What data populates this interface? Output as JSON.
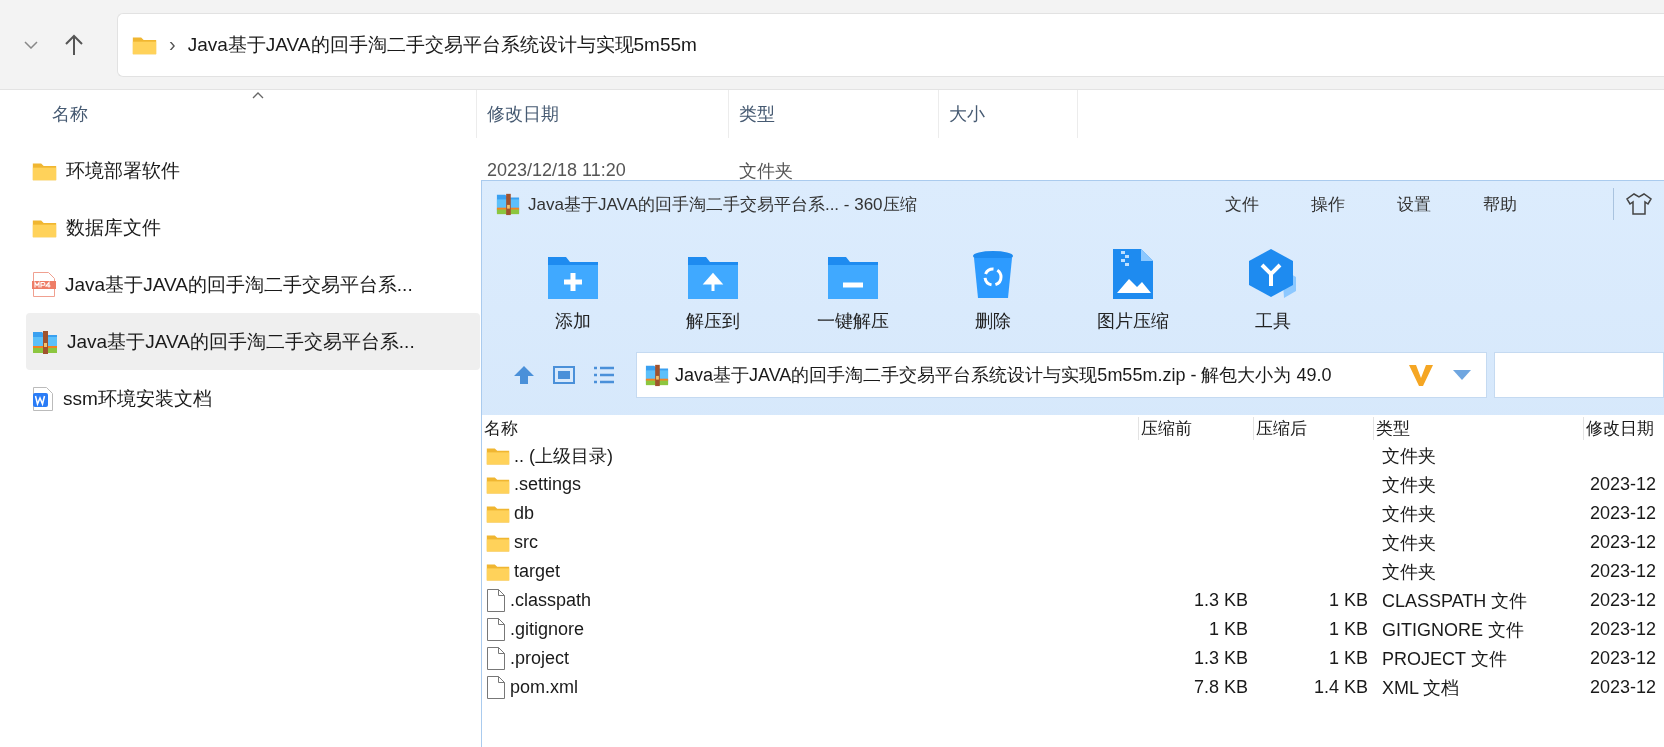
{
  "explorer": {
    "path": "Java基于JAVA的回手淘二手交易平台系统设计与实现5m55m",
    "path_separator": "›",
    "columns": [
      "名称",
      "修改日期",
      "类型",
      "大小"
    ],
    "rows": [
      {
        "kind": "folder",
        "name": "环境部署软件",
        "date": "2023/12/18 11:20",
        "type": "文件夹",
        "selected": false
      },
      {
        "kind": "folder",
        "name": "数据库文件",
        "selected": false
      },
      {
        "kind": "video",
        "name": "Java基于JAVA的回手淘二手交易平台系...",
        "selected": false
      },
      {
        "kind": "archive",
        "name": "Java基于JAVA的回手淘二手交易平台系...",
        "selected": true
      },
      {
        "kind": "document",
        "name": "ssm环境安装文档",
        "selected": false
      }
    ]
  },
  "archiver": {
    "title": "Java基于JAVA的回手淘二手交易平台系... - 360压缩",
    "menu": [
      "文件",
      "操作",
      "设置",
      "帮助"
    ],
    "toolbar": [
      {
        "kind": "add",
        "label": "添加"
      },
      {
        "kind": "extract-to",
        "label": "解压到"
      },
      {
        "kind": "extract",
        "label": "一键解压"
      },
      {
        "kind": "delete",
        "label": "删除"
      },
      {
        "kind": "image",
        "label": "图片压缩"
      },
      {
        "kind": "tools",
        "label": "工具"
      }
    ],
    "address": "Java基于JAVA的回手淘二手交易平台系统设计与实现5m55m.zip - 解包大小为 49.0",
    "columns": [
      "名称",
      "压缩前",
      "压缩后",
      "类型",
      "修改日期"
    ],
    "rows": [
      {
        "kind": "folder",
        "name": ".. (上级目录)",
        "type": "文件夹"
      },
      {
        "kind": "folder",
        "name": ".settings",
        "type": "文件夹",
        "date": "2023-12"
      },
      {
        "kind": "folder",
        "name": "db",
        "type": "文件夹",
        "date": "2023-12"
      },
      {
        "kind": "folder",
        "name": "src",
        "type": "文件夹",
        "date": "2023-12"
      },
      {
        "kind": "folder",
        "name": "target",
        "type": "文件夹",
        "date": "2023-12"
      },
      {
        "kind": "file",
        "name": ".classpath",
        "before": "1.3 KB",
        "after": "1 KB",
        "type": "CLASSPATH 文件",
        "date": "2023-12"
      },
      {
        "kind": "file",
        "name": ".gitignore",
        "before": "1 KB",
        "after": "1 KB",
        "type": "GITIGNORE 文件",
        "date": "2023-12"
      },
      {
        "kind": "file",
        "name": ".project",
        "before": "1.3 KB",
        "after": "1 KB",
        "type": "PROJECT 文件",
        "date": "2023-12"
      },
      {
        "kind": "file",
        "name": "pom.xml",
        "before": "7.8 KB",
        "after": "1.4 KB",
        "type": "XML 文档",
        "date": "2023-12"
      }
    ]
  }
}
